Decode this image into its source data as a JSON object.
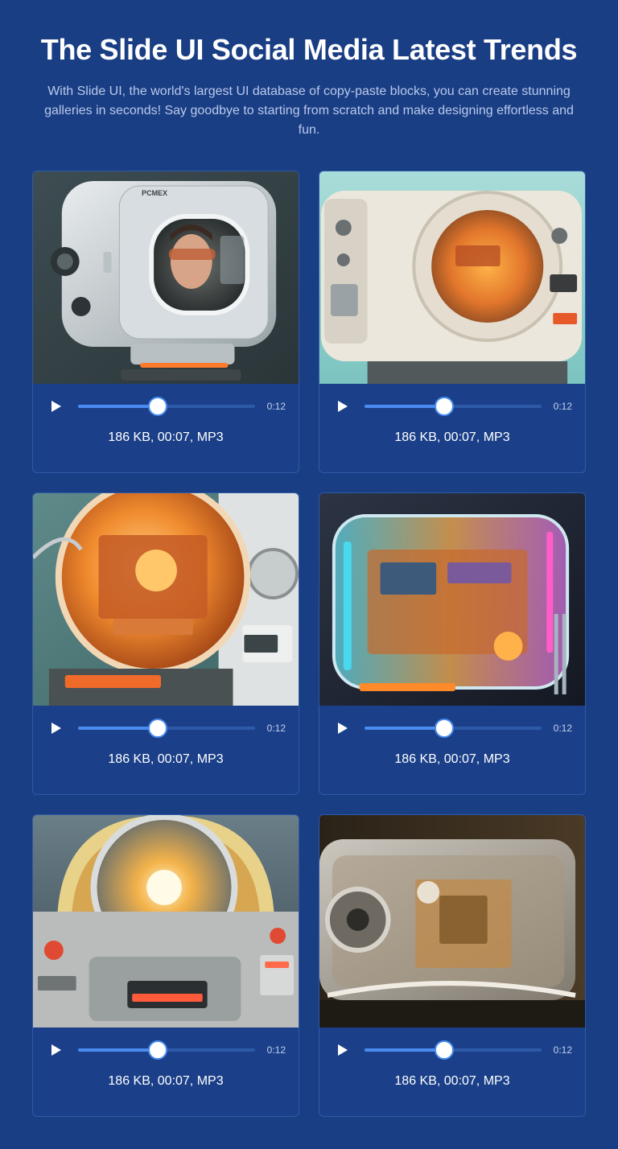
{
  "hero": {
    "title": "The Slide UI Social Media Latest Trends",
    "subtitle": "With Slide UI, the world's largest UI database of copy-paste blocks, you can create stunning galleries in seconds! Say goodbye to starting from scratch and make designing effortless and fun."
  },
  "colors": {
    "background": "#1a3e84",
    "card_border": "#2e5aa8",
    "accent": "#4a8cf0"
  },
  "cards": [
    {
      "image": "retro-tv-robot-face",
      "image_label": "PCMEX",
      "time": "0:12",
      "progress": 0.45,
      "meta": "186 KB, 00:07, MP3"
    },
    {
      "image": "retro-cream-machine",
      "time": "0:12",
      "progress": 0.45,
      "meta": "186 KB, 00:07, MP3"
    },
    {
      "image": "orange-glass-reactor",
      "time": "0:12",
      "progress": 0.45,
      "meta": "186 KB, 00:07, MP3"
    },
    {
      "image": "transparent-neon-computer",
      "time": "0:12",
      "progress": 0.45,
      "meta": "186 KB, 00:07, MP3"
    },
    {
      "image": "jukebox-dome-machine",
      "time": "0:12",
      "progress": 0.45,
      "meta": "186 KB, 00:07, MP3"
    },
    {
      "image": "clear-mechanical-box",
      "time": "0:12",
      "progress": 0.45,
      "meta": "186 KB, 00:07, MP3"
    }
  ]
}
